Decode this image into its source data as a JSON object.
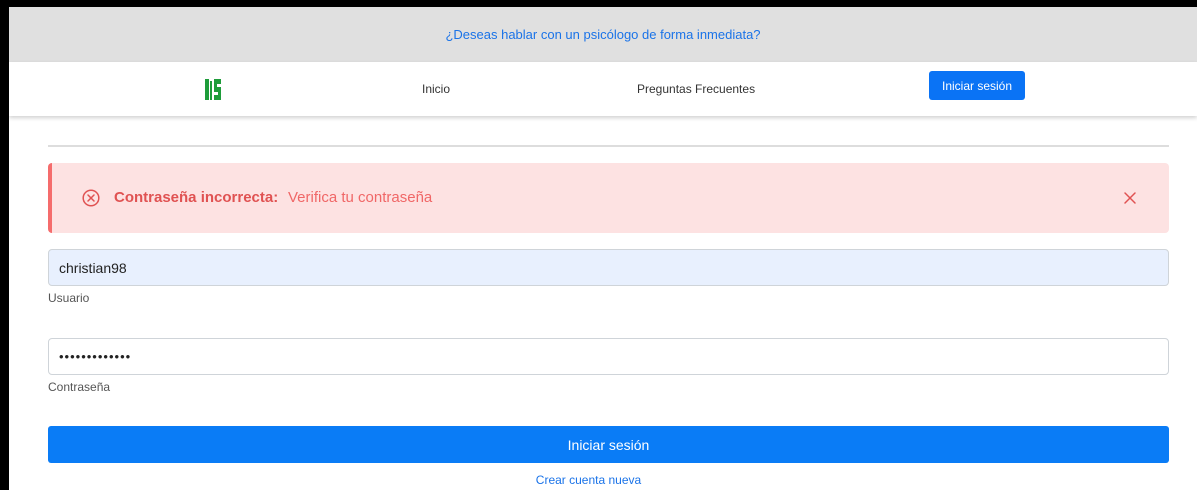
{
  "topbar": {
    "link_text": "¿Deseas hablar con un psicólogo de forma inmediata?"
  },
  "navbar": {
    "logo_icon": "university-logo-icon",
    "items": [
      {
        "label": "Inicio"
      },
      {
        "label": "Preguntas Frecuentes"
      }
    ],
    "login_label": "Iniciar sesión"
  },
  "alert": {
    "icon": "error-circle-icon",
    "title": "Contraseña incorrecta:",
    "message": "Verifica tu contraseña",
    "close_icon": "close-icon",
    "colors": {
      "background": "#fde2e2",
      "border": "#f56c6c",
      "text": "#e05252"
    }
  },
  "form": {
    "username": {
      "value": "christian98",
      "label": "Usuario"
    },
    "password": {
      "value": "•••••••••••••",
      "label": "Contraseña"
    },
    "submit_label": "Iniciar sesión",
    "create_account_label": "Crear cuenta nueva"
  },
  "colors": {
    "accent": "#0a7cf6",
    "logo": "#1e9c3a"
  }
}
